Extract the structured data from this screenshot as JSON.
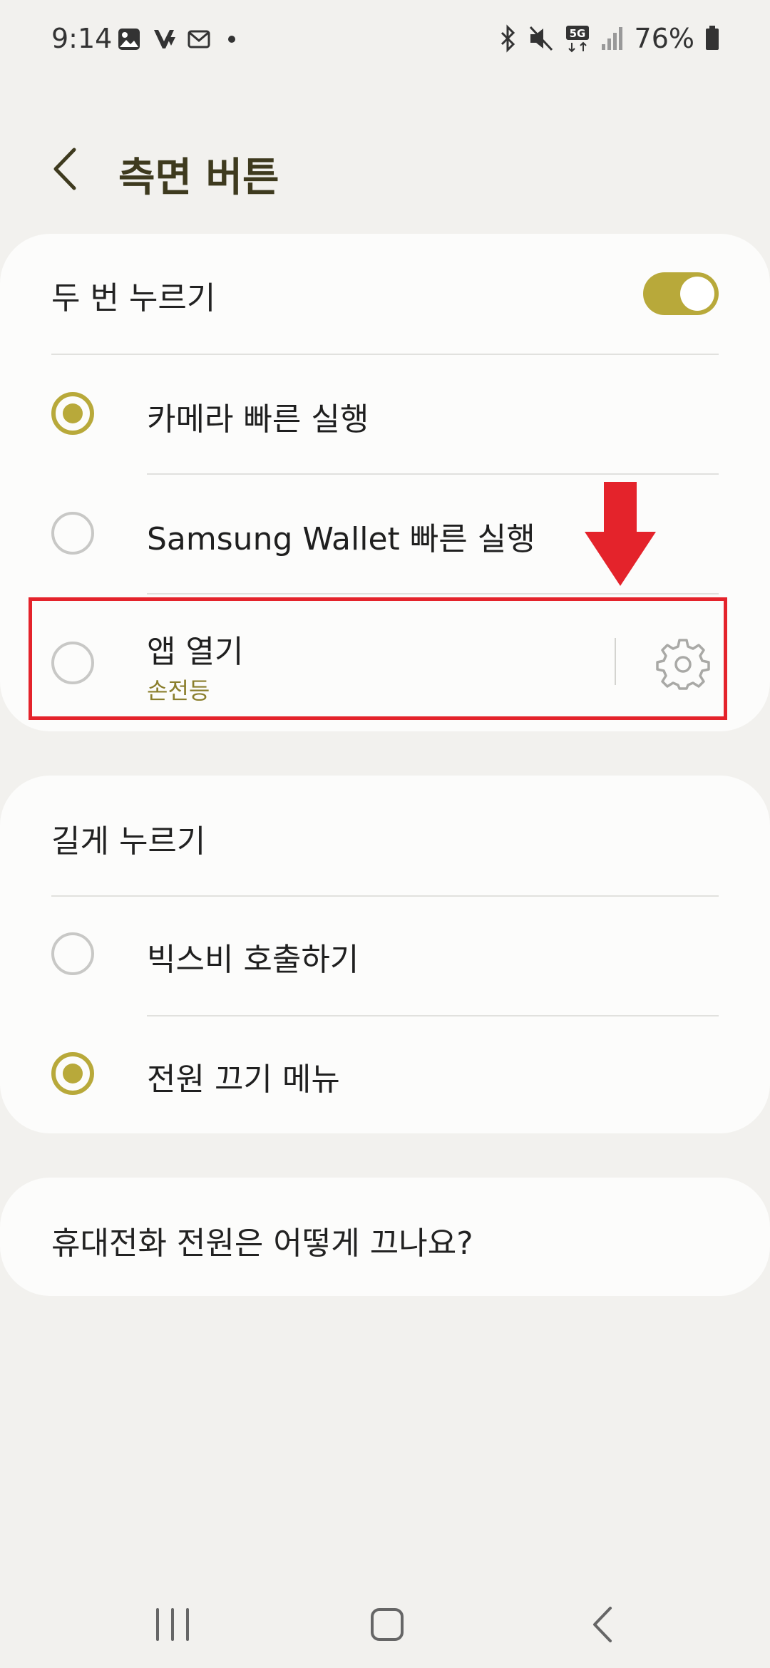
{
  "status_bar": {
    "time": "9:14",
    "battery_text": "76%",
    "icons_left": [
      "gallery-icon",
      "app-icon",
      "mail-icon",
      "dot-icon"
    ],
    "icons_right": [
      "bluetooth-icon",
      "mute-icon",
      "5g-icon",
      "signal-icon",
      "battery-icon"
    ]
  },
  "header": {
    "title": "측면 버튼"
  },
  "double_press": {
    "label": "두 번 누르기",
    "toggle_on": true,
    "options": [
      {
        "label": "카메라 빠른 실행",
        "selected": true
      },
      {
        "label": "Samsung Wallet 빠른 실행",
        "selected": false
      },
      {
        "label": "앱 열기",
        "sub": "손전등",
        "selected": false
      }
    ]
  },
  "long_press": {
    "label": "길게 누르기",
    "options": [
      {
        "label": "빅스비 호출하기",
        "selected": false
      },
      {
        "label": "전원 끄기 메뉴",
        "selected": true
      }
    ]
  },
  "help_link": {
    "label": "휴대전화 전원은 어떻게 끄나요?"
  },
  "colors": {
    "accent": "#b8a93a",
    "annotation": "#e4232b",
    "background": "#f2f1ee",
    "card": "#fcfcfb"
  },
  "nav_bar": [
    "recent-apps-icon",
    "home-icon",
    "back-icon"
  ]
}
